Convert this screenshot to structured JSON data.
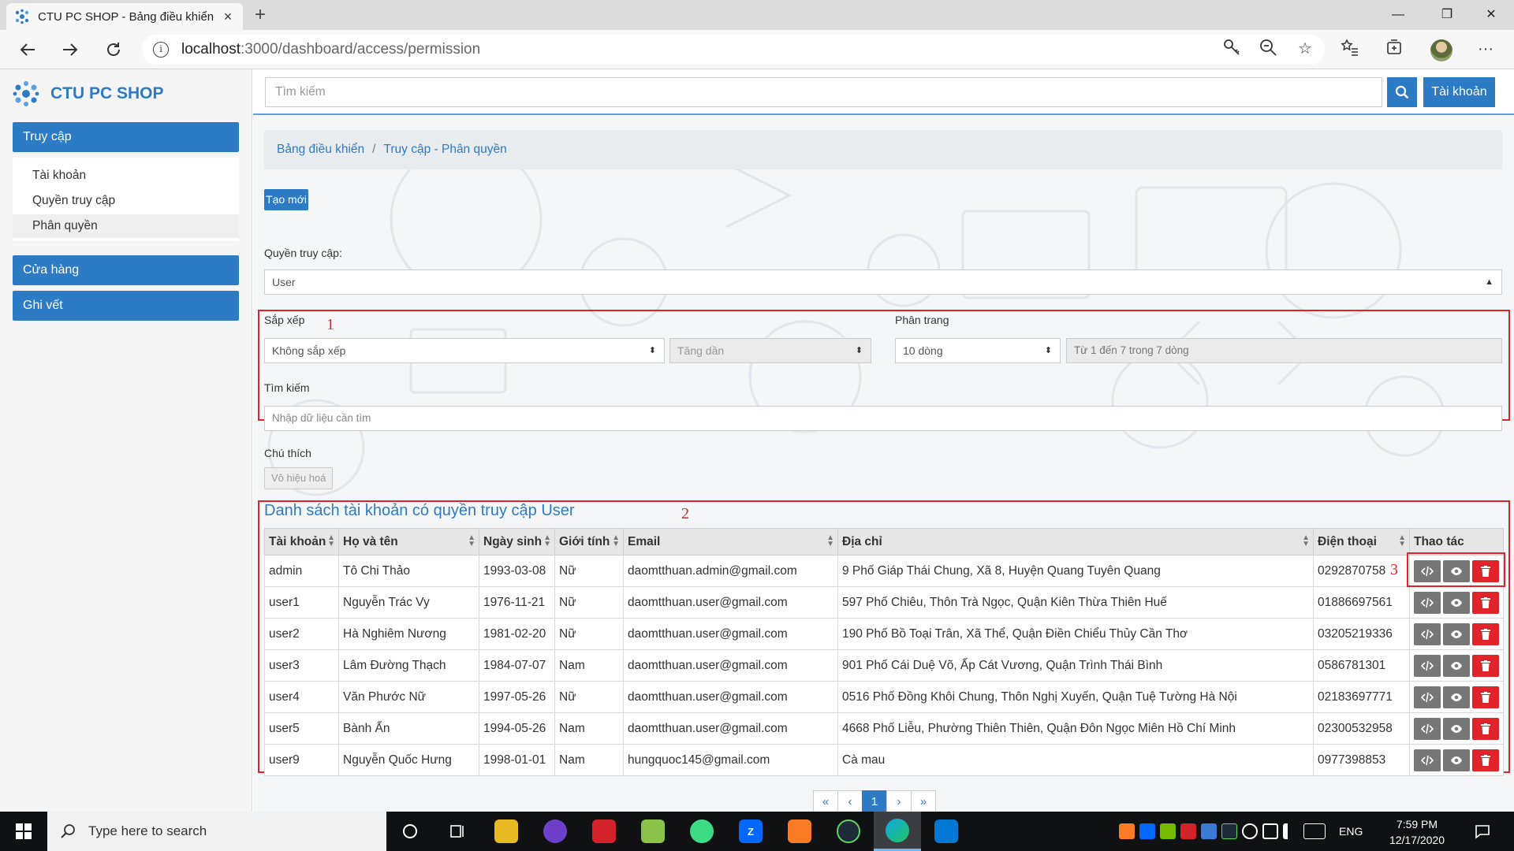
{
  "browser": {
    "tab_title": "CTU PC SHOP - Bảng điều khiển",
    "url_host": "localhost",
    "url_path": ":3000/dashboard/access/permission"
  },
  "sidebar": {
    "brand": "CTU PC SHOP",
    "sections": [
      {
        "label": "Truy cập"
      },
      {
        "label": "Cửa hàng"
      },
      {
        "label": "Ghi vết"
      }
    ],
    "sub_items": [
      {
        "label": "Tài khoản"
      },
      {
        "label": "Quyền truy cập"
      },
      {
        "label": "Phân quyền"
      }
    ]
  },
  "header": {
    "search_placeholder": "Tìm kiếm",
    "account_label": "Tài khoản"
  },
  "breadcrumb": {
    "home": "Bảng điều khiển",
    "current": "Truy cập - Phân quyền"
  },
  "form": {
    "create_label": "Tạo mới",
    "role_label": "Quyền truy cập:",
    "role_value": "User",
    "sort_label": "Sắp xếp",
    "sort_value": "Không sắp xếp",
    "order_value": "Tăng dần",
    "paging_label": "Phân trang",
    "paging_value": "10 dòng",
    "paging_info": "Từ 1 đến 7 trong 7 dòng",
    "search_label": "Tìm kiếm",
    "search_placeholder": "Nhập dữ liệu cần tìm",
    "legend_label": "Chú thích",
    "legend_disabled": "Vô hiệu hoá"
  },
  "annotations": {
    "n1": "1",
    "n2": "2",
    "n3": "3"
  },
  "table": {
    "title": "Danh sách tài khoản có quyền truy cập User",
    "columns": [
      "Tài khoản",
      "Họ và tên",
      "Ngày sinh",
      "Giới tính",
      "Email",
      "Địa chỉ",
      "Điện thoại",
      "Thao tác"
    ],
    "rows": [
      [
        "admin",
        "Tô Chi Thảo",
        "1993-03-08",
        "Nữ",
        "daomtthuan.admin@gmail.com",
        "9 Phố Giáp Thái Chung, Xã 8, Huyện Quang Tuyên Quang",
        "0292870758"
      ],
      [
        "user1",
        "Nguyễn Trác Vy",
        "1976-11-21",
        "Nữ",
        "daomtthuan.user@gmail.com",
        "597 Phố Chiêu, Thôn Trà Ngọc, Quận Kiên Thừa Thiên Huế",
        "01886697561"
      ],
      [
        "user2",
        "Hà Nghiêm Nương",
        "1981-02-20",
        "Nữ",
        "daomtthuan.user@gmail.com",
        "190 Phố Bồ Toại Trân, Xã Thể, Quận Điền Chiểu Thủy Cần Thơ",
        "03205219336"
      ],
      [
        "user3",
        "Lâm Đường Thạch",
        "1984-07-07",
        "Nam",
        "daomtthuan.user@gmail.com",
        "901 Phố Cái Duệ Võ, Ấp Cát Vương, Quận Trình Thái Bình",
        "0586781301"
      ],
      [
        "user4",
        "Văn Phước Nữ",
        "1997-05-26",
        "Nữ",
        "daomtthuan.user@gmail.com",
        "0516 Phố Đồng Khôi Chung, Thôn Nghị Xuyến, Quận Tuệ Tường Hà Nội",
        "02183697771"
      ],
      [
        "user5",
        "Bành Ẩn",
        "1994-05-26",
        "Nam",
        "daomtthuan.user@gmail.com",
        "4668 Phố Liễu, Phường Thiên Thiên, Quận Đôn Ngọc Miên Hồ Chí Minh",
        "02300532958"
      ],
      [
        "user9",
        "Nguyễn Quốc Hưng",
        "1998-01-01",
        "Nam",
        "hungquoc145@gmail.com",
        "Cà mau",
        "0977398853"
      ]
    ]
  },
  "pagination": {
    "first": "«",
    "prev": "‹",
    "current": "1",
    "next": "›",
    "last": "»"
  },
  "taskbar": {
    "search_placeholder": "Type here to search",
    "lang": "ENG",
    "time": "7:59 PM",
    "date": "12/17/2020"
  },
  "colors": {
    "primary": "#2d7bc4",
    "danger": "#e0242b",
    "annotation": "#e0242b"
  }
}
